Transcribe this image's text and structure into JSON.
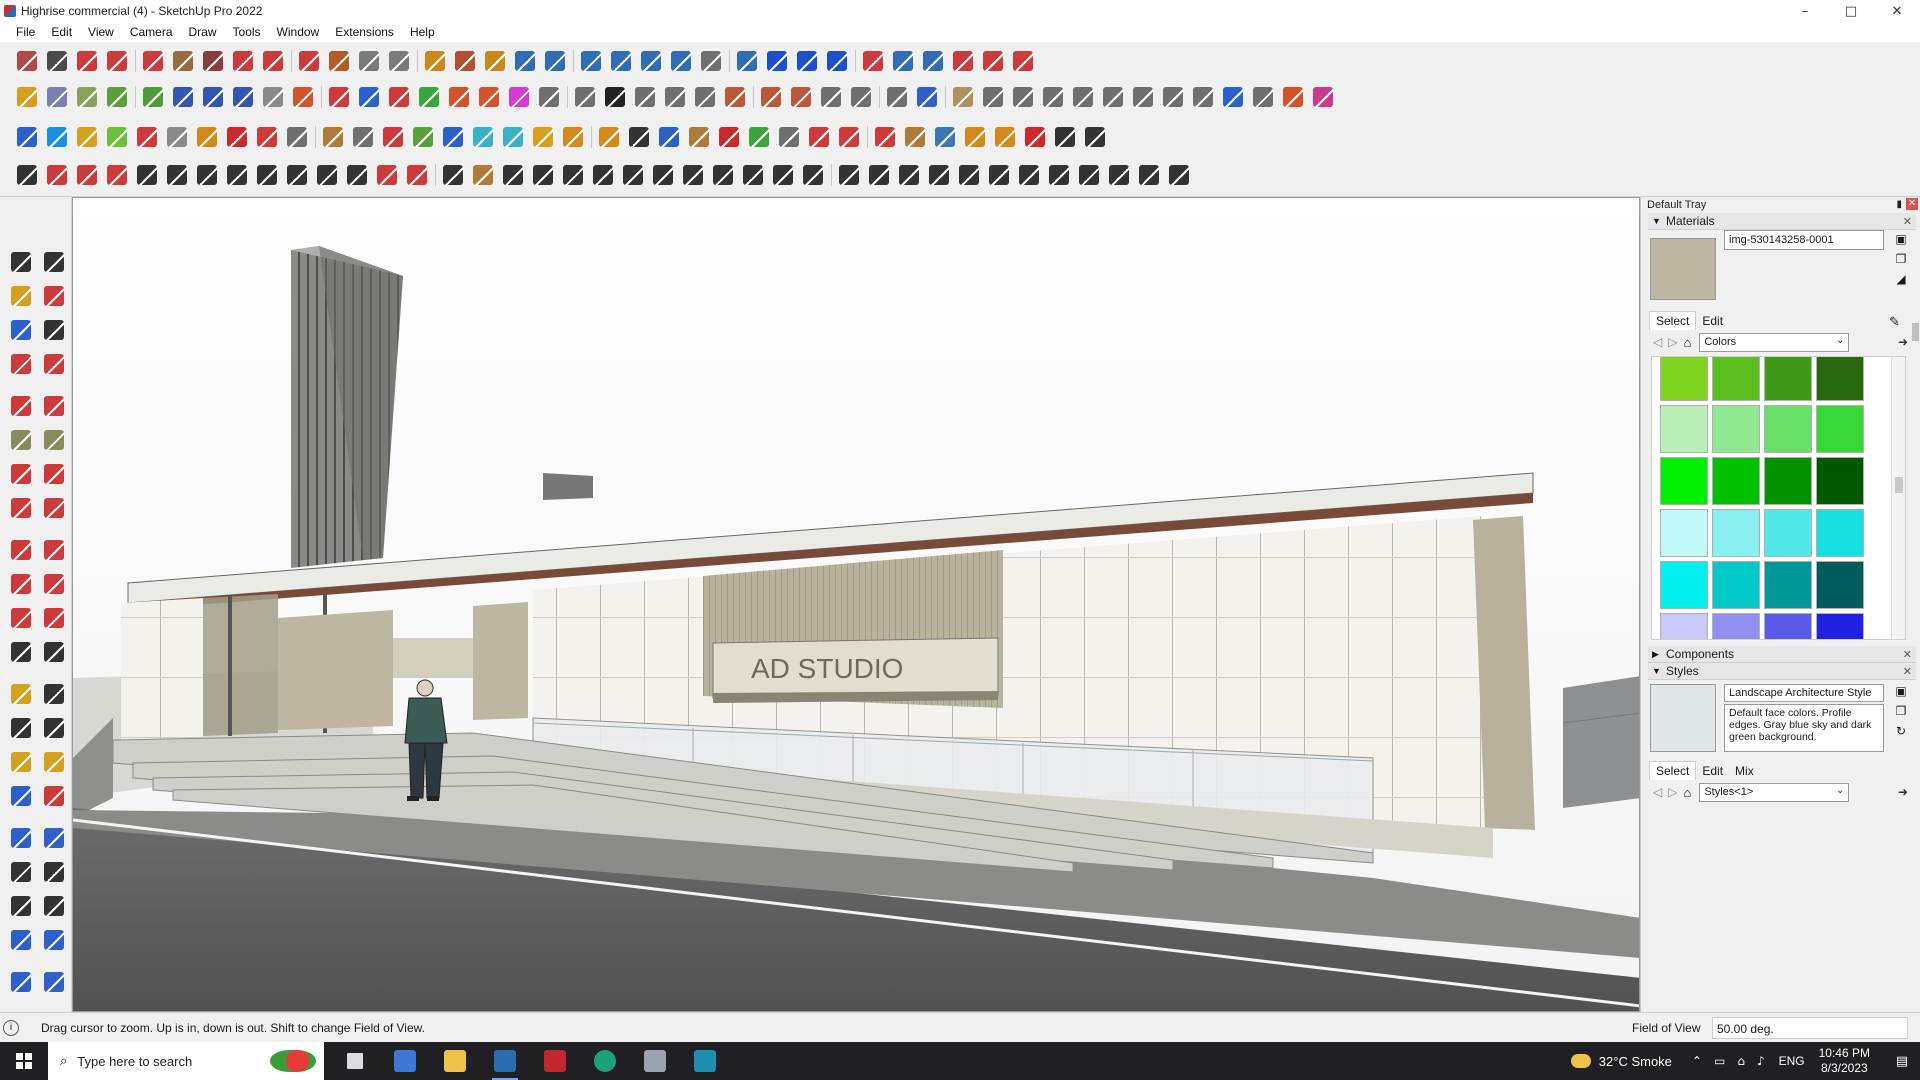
{
  "window": {
    "title": "Highrise commercial (4) - SketchUp Pro 2022",
    "controls": [
      "–",
      "□",
      "✕"
    ]
  },
  "menu": [
    "File",
    "Edit",
    "View",
    "Camera",
    "Draw",
    "Tools",
    "Window",
    "Extensions",
    "Help"
  ],
  "toolbar_icons": {
    "row1": [
      "#b04a4a",
      "#4a4a4a",
      "#cc3b3b",
      "#cc3b3b",
      "#cc3b3b",
      "#9a6a3c",
      "#8a3c3c",
      "#cc3b3b",
      "#cc3b3b",
      "#cc3b3b",
      "#b55a2a",
      "#7a7a7a",
      "#7a7a7a",
      "#c98a1b",
      "#b05030",
      "#c98a1b",
      "#2f6db5",
      "#2f6db5",
      "#2f6db5",
      "#2f6db5",
      "#2f6db5",
      "#2f6db5",
      "#6f6f6f",
      "#2f6db5",
      "#1c50c8",
      "#1c50c8",
      "#1c50c8",
      "#cc3b3b",
      "#2f6db5",
      "#2f6db5",
      "#cc3b3b",
      "#cc3b3b",
      "#cc3b3b"
    ],
    "row2": [
      "#d4a01e",
      "#7b7fb0",
      "#8aa35a",
      "#5aa03a",
      "#4f9a3a",
      "#3556b0",
      "#3556b0",
      "#3556b0",
      "#8a8a8a",
      "#d2532a",
      "#cc3b3b",
      "#2d61c9",
      "#cc3b3b",
      "#3aa53a",
      "#d2532a",
      "#d2532a",
      "#d43ad4",
      "#6f6f6f",
      "#6f6f6f",
      "#222",
      "#6f6f6f",
      "#6f6f6f",
      "#6f6f6f",
      "#b85a3a",
      "#b85a3a",
      "#b85a3a",
      "#6f6f6f",
      "#6f6f6f",
      "#6f6f6f",
      "#2d61c9",
      "#b09060",
      "#6f6f6f",
      "#6f6f6f",
      "#6f6f6f",
      "#6f6f6f",
      "#6f6f6f",
      "#6f6f6f",
      "#6f6f6f",
      "#6f6f6f",
      "#2d61c9",
      "#6f6f6f",
      "#d2532a",
      "#c93a8a"
    ],
    "row3": [
      "#2d61c9",
      "#1d8fe0",
      "#d4a01e",
      "#6dbf3a",
      "#cc3b3b",
      "#8a8a8a",
      "#d48a1b",
      "#cc2a2a",
      "#cc3b3b",
      "#6f6f6f",
      "#b07a3a",
      "#6f6f6f",
      "#cc3b3b",
      "#5aa03a",
      "#2d61c9",
      "#3ab0c9",
      "#3ab0c9",
      "#d4a01e",
      "#d48a1b",
      "#d48a1b",
      "#333",
      "#2d61c9",
      "#b07a3a",
      "#cc2a2a",
      "#3aa53a",
      "#6f6f6f",
      "#cc3b3b",
      "#cc3b3b",
      "#cc3b3b",
      "#b07a3a",
      "#3a7ab0",
      "#d48a1b",
      "#d48a1b",
      "#cc2a2a",
      "#333",
      "#333"
    ],
    "row4": [
      "#333",
      "#cc3b3b",
      "#cc3b3b",
      "#cc3b3b",
      "#333",
      "#333",
      "#333",
      "#333",
      "#333",
      "#333",
      "#333",
      "#333",
      "#cc3b3b",
      "#cc3b3b",
      "#333",
      "#b07a3a",
      "#333",
      "#333",
      "#333",
      "#333",
      "#333",
      "#333",
      "#333",
      "#333",
      "#333",
      "#333",
      "#333",
      "#333",
      "#333",
      "#333",
      "#333",
      "#333",
      "#333",
      "#333",
      "#333",
      "#333",
      "#333",
      "#333",
      "#333"
    ]
  },
  "left_tools": [
    "#333",
    "#333",
    "#d4a01e",
    "#cc3b3b",
    "#2d61c9",
    "#333",
    "#cc3b3b",
    "#cc3b3b",
    "#cc3b3b",
    "#cc3b3b",
    "#8a8a5a",
    "#8a8a5a",
    "#cc3b3b",
    "#cc3b3b",
    "#cc3b3b",
    "#cc3b3b",
    "#cc3b3b",
    "#cc3b3b",
    "#cc3b3b",
    "#cc3b3b",
    "#cc3b3b",
    "#cc3b3b",
    "#333",
    "#333",
    "#d4a01e",
    "#333",
    "#333",
    "#333",
    "#d4a01e",
    "#d4a01e",
    "#2d61c9",
    "#cc3b3b",
    "#2d61c9",
    "#2d61c9",
    "#333",
    "#333",
    "#333",
    "#333",
    "#2d61c9",
    "#2d61c9",
    "#2d61c9",
    "#2d61c9"
  ],
  "tray": {
    "title": "Default Tray",
    "materials": {
      "title": "Materials",
      "name": "img-530143258-0001",
      "swatch_color": "#bdb6a2",
      "tabs": [
        "Select",
        "Edit"
      ],
      "library": "Colors",
      "colors": [
        "#7ed321",
        "#5cbf1f",
        "#3f9a17",
        "#2b6b10",
        "#b8f0b8",
        "#90e890",
        "#68e068",
        "#38d838",
        "#00ee00",
        "#00c000",
        "#009000",
        "#005800",
        "#c0f8f8",
        "#88f0f0",
        "#50e8e8",
        "#18e0e0",
        "#00f0f0",
        "#00c8c8",
        "#009898",
        "#005c5c",
        "#c8c8f8",
        "#9090f0",
        "#5a5ae8",
        "#2020e0"
      ]
    },
    "components": {
      "title": "Components"
    },
    "styles": {
      "title": "Styles",
      "name": "Landscape Architecture Style",
      "description": "Default face colors. Profile edges. Gray blue sky and dark green background.",
      "tabs": [
        "Select",
        "Edit",
        "Mix"
      ],
      "library": "Styles<1>"
    }
  },
  "scene": {
    "sign_text": "AD STUDIO"
  },
  "status": {
    "message": "Drag cursor to zoom.  Up is in, down is out. Shift to change Field of View.",
    "measure_label": "Field of View",
    "measure_value": "50.00 deg."
  },
  "taskbar": {
    "search_placeholder": "Type here to search",
    "weather": "32°C  Smoke",
    "language": "ENG",
    "time": "10:46 PM",
    "date": "8/3/2023"
  }
}
